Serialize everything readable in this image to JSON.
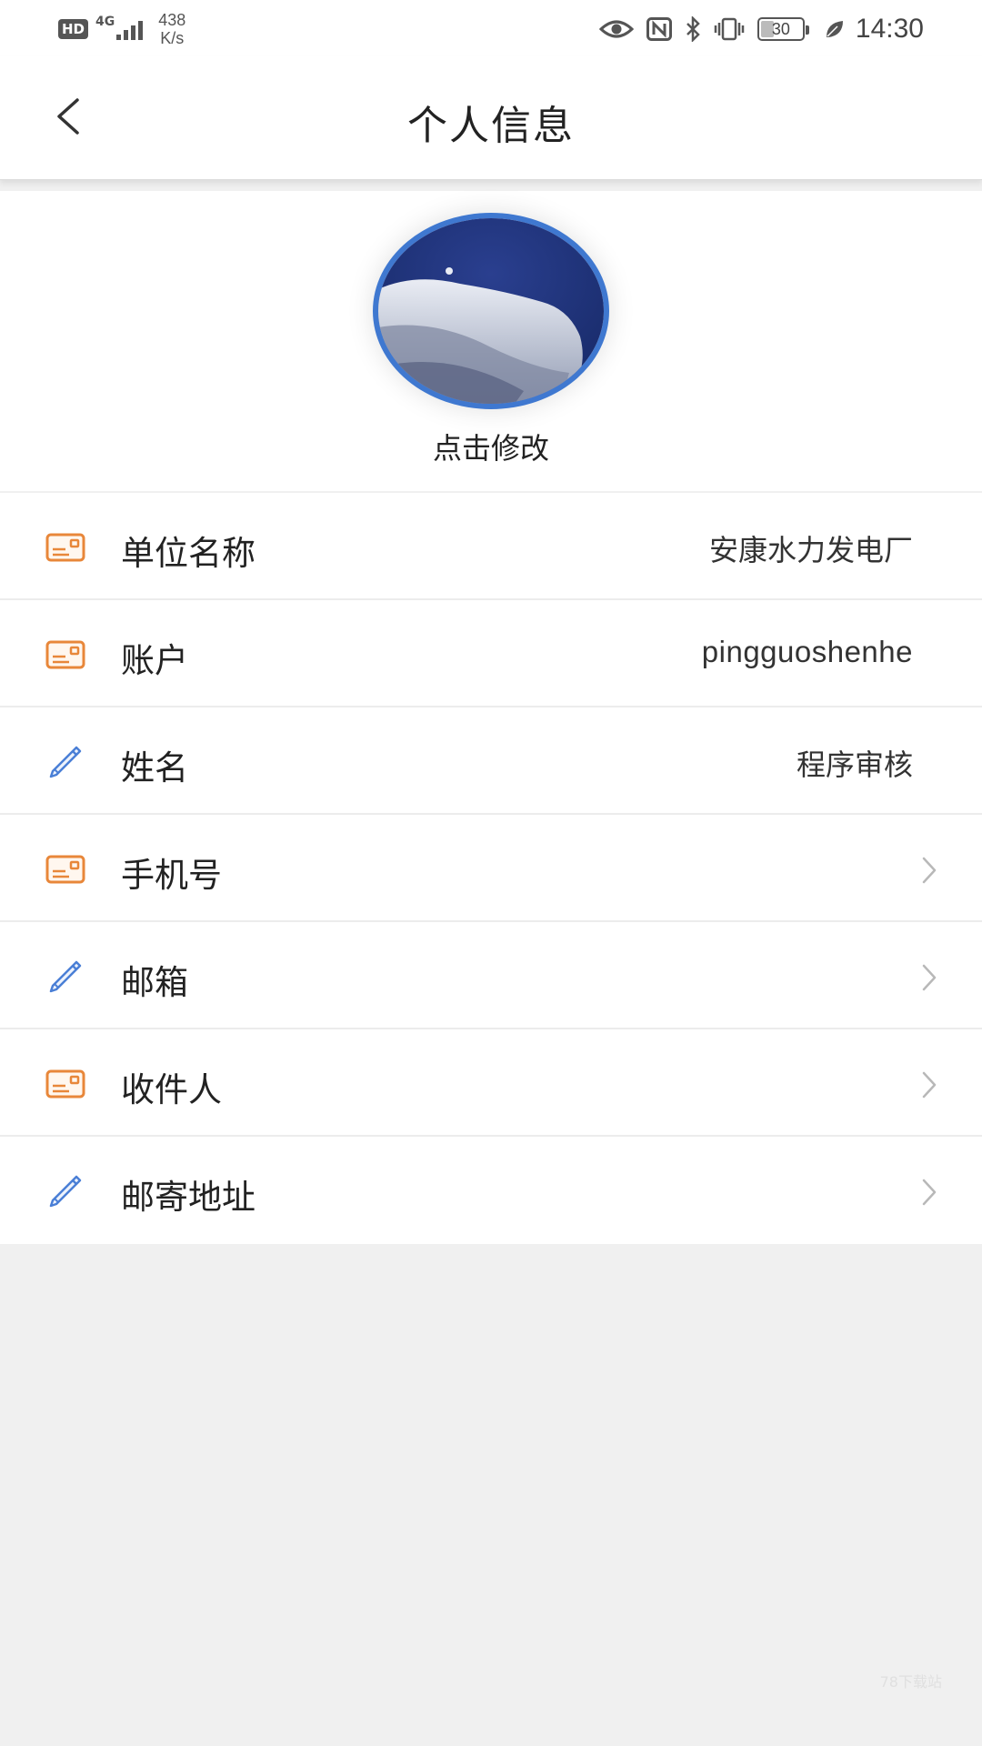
{
  "status_bar": {
    "hd_badge": "HD",
    "network": "4G",
    "speed_value": "438",
    "speed_unit": "K/s",
    "battery_level": "30",
    "time": "14:30",
    "icons": [
      "eye-icon",
      "nfc-icon",
      "bluetooth-icon",
      "vibrate-icon",
      "battery-icon",
      "leaf-icon"
    ]
  },
  "header": {
    "title": "个人信息",
    "back_icon": "chevron-left-icon"
  },
  "avatar": {
    "caption": "点击修改",
    "border_color": "#3f78d0"
  },
  "rows": [
    {
      "label": "单位名称",
      "value": "安康水力发电厂",
      "icon": "id-card-icon",
      "has_arrow": false
    },
    {
      "label": "账户",
      "value": "pingguoshenhe",
      "icon": "id-card-icon",
      "has_arrow": false
    },
    {
      "label": "姓名",
      "value": "程序审核",
      "icon": "pencil-icon",
      "has_arrow": false
    },
    {
      "label": "手机号",
      "value": "",
      "icon": "id-card-icon",
      "has_arrow": true
    },
    {
      "label": "邮箱",
      "value": "",
      "icon": "pencil-icon",
      "has_arrow": true
    },
    {
      "label": "收件人",
      "value": "",
      "icon": "id-card-icon",
      "has_arrow": true
    },
    {
      "label": "邮寄地址",
      "value": "",
      "icon": "pencil-icon",
      "has_arrow": true
    }
  ],
  "colors": {
    "card_icon": "#e8873a",
    "pencil_icon": "#4a7fd6",
    "avatar_border": "#3f78d0",
    "background": "#f0f0f0"
  },
  "watermark": "78下载站"
}
